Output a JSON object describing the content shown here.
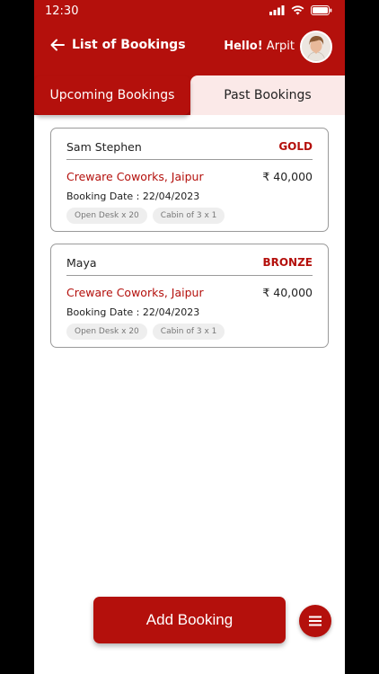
{
  "status_bar": {
    "time": "12:30"
  },
  "header": {
    "title": "List of Bookings",
    "greeting_prefix": "Hello!",
    "greeting_name": "Arpit"
  },
  "tabs": [
    {
      "label": "Upcoming Bookings",
      "active": true
    },
    {
      "label": "Past  Bookings",
      "active": false
    }
  ],
  "bookings": [
    {
      "customer": "Sam Stephen",
      "tier": "GOLD",
      "venue": "Creware Coworks, Jaipur",
      "price": "₹ 40,000",
      "date_label": "Booking Date :",
      "date": "22/04/2023",
      "chips": [
        "Open Desk x 20",
        "Cabin of 3 x 1"
      ]
    },
    {
      "customer": "Maya",
      "tier": "BRONZE",
      "venue": "Creware Coworks, Jaipur",
      "price": "₹ 40,000",
      "date_label": "Booking Date :",
      "date": "22/04/2023",
      "chips": [
        "Open Desk x 20",
        "Cabin of 3 x 1"
      ]
    }
  ],
  "actions": {
    "add_booking": "Add Booking"
  },
  "colors": {
    "brand": "#b4100c",
    "tab_inactive_bg": "#fbe9e8"
  },
  "icons": [
    "signal-icon",
    "wifi-icon",
    "battery-icon",
    "back-arrow-icon",
    "avatar",
    "menu-icon"
  ]
}
